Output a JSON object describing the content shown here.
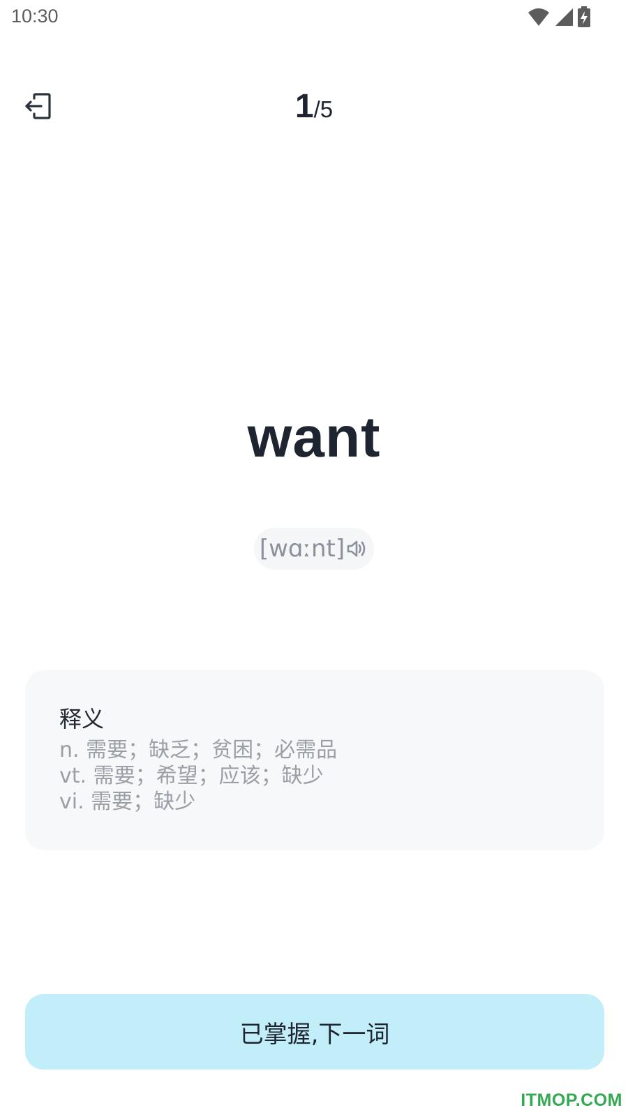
{
  "status_bar": {
    "time": "10:30",
    "icons": [
      "wifi-icon",
      "signal-icon",
      "battery-charging-icon"
    ]
  },
  "header": {
    "progress_current": "1",
    "progress_separator": "/",
    "progress_total": "5"
  },
  "word": {
    "text": "want",
    "phonetic": "[wɑːnt]"
  },
  "definition": {
    "title": "释义",
    "lines": [
      "n. 需要；缺乏；贫困；必需品",
      "vt. 需要；希望；应该；缺少",
      "vi. 需要；缺少"
    ]
  },
  "actions": {
    "next_label": "已掌握,下一词"
  },
  "watermark": "ITMOP.COM",
  "colors": {
    "accent_button": "#c2eefa",
    "text_primary": "#1f2530",
    "text_secondary": "#9a9fa6",
    "card_bg": "#f7f8fa",
    "watermark": "#34a853"
  }
}
